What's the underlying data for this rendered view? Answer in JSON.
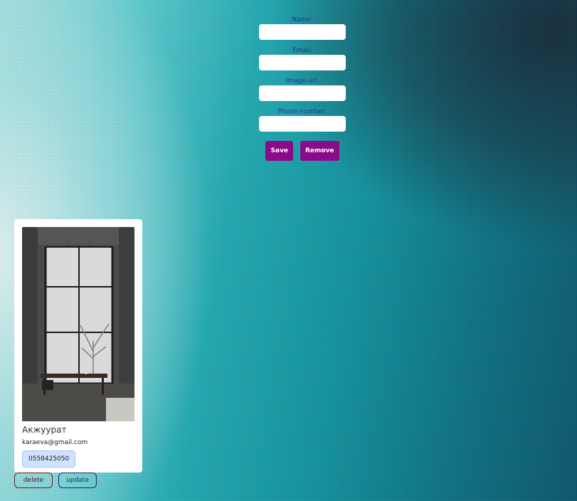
{
  "form": {
    "name_label": "Name:",
    "email_label": "Email:",
    "image_label": "Image-url:",
    "phone_label": "Phone-number:",
    "name_value": "",
    "email_value": "",
    "image_value": "",
    "phone_value": "",
    "save_label": "Save",
    "remove_label": "Remove"
  },
  "card": {
    "image_alt": "interior-photo",
    "name": "Акжуурат",
    "email": "karaeva@gmail.com",
    "phone": "0558425050",
    "delete_label": "delete",
    "update_label": "update"
  },
  "colors": {
    "button_bg": "#8a0a8a",
    "label_text": "#2b2fa0",
    "phone_badge_bg": "#cfe2ff"
  }
}
